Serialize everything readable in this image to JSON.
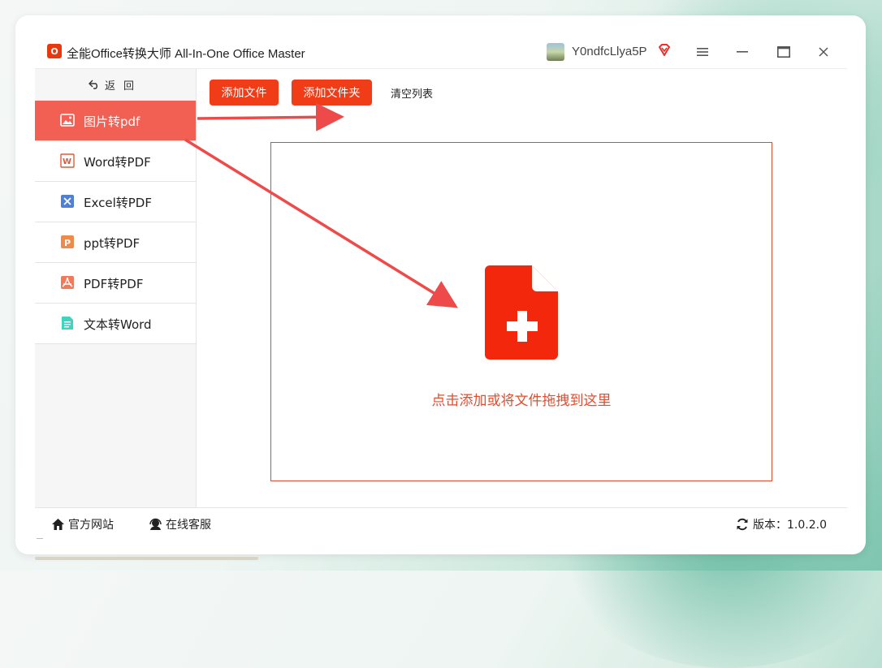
{
  "window": {
    "title": "全能Office转换大师 All-In-One Office Master",
    "logo_glyph": "O",
    "username": "Y0ndfcLlya5P",
    "icons": [
      "user-avatar",
      "vip-diamond-icon",
      "menu-icon",
      "minimize-icon",
      "maximize-icon",
      "close-icon"
    ]
  },
  "sidebar": {
    "back_label": "返回",
    "items": [
      {
        "label": "图片转pdf",
        "icon": "image-icon",
        "active": true
      },
      {
        "label": "Word转PDF",
        "icon": "word-icon",
        "active": false
      },
      {
        "label": "Excel转PDF",
        "icon": "excel-icon",
        "active": false
      },
      {
        "label": "ppt转PDF",
        "icon": "ppt-icon",
        "active": false
      },
      {
        "label": "PDF转PDF",
        "icon": "pdf-icon",
        "active": false
      },
      {
        "label": "文本转Word",
        "icon": "text-doc-icon",
        "active": false
      }
    ]
  },
  "toolbar": {
    "add_file": "添加文件",
    "add_folder": "添加文件夹",
    "clear_list": "清空列表"
  },
  "dropzone": {
    "icon": "add-file-icon",
    "text": "点击添加或将文件拖拽到这里"
  },
  "footer": {
    "website": "官方网站",
    "support": "在线客服",
    "version": "版本：1.0.2.0"
  },
  "colors": {
    "accent": "#f03c17",
    "active_item": "#f25f53",
    "dropzone_border": "#e04a2f",
    "drop_text": "#e14d2f",
    "annotation_arrow": "#ef4a4a"
  }
}
